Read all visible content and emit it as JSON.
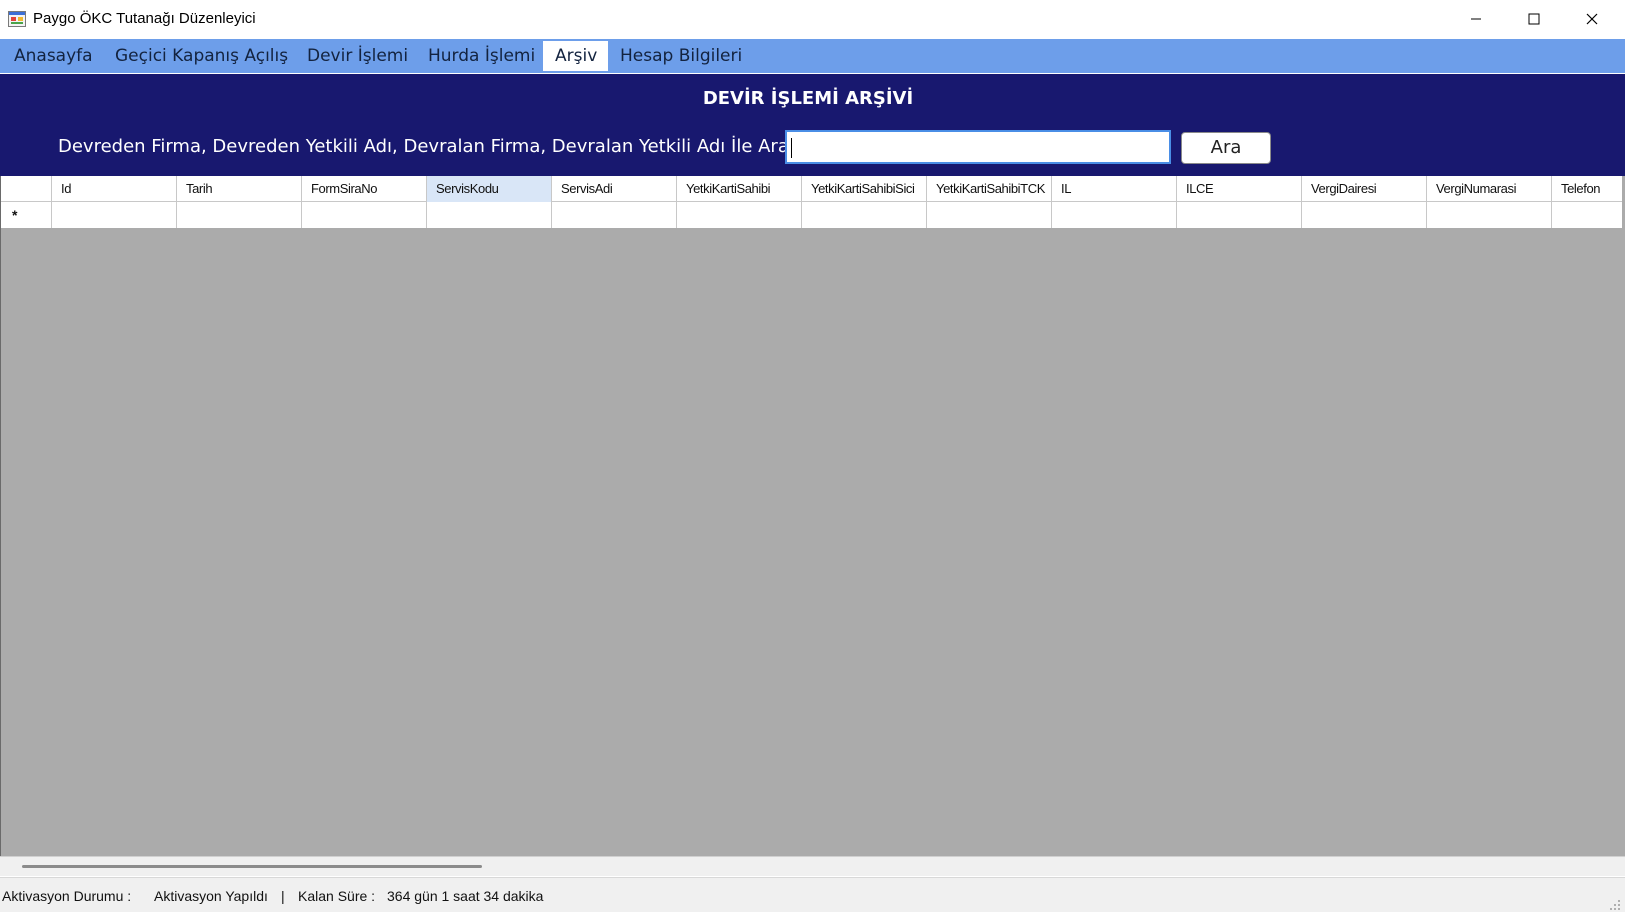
{
  "window": {
    "title": "Paygo ÖKC Tutanağı Düzenleyici",
    "icon": "app-form-icon",
    "controls": [
      "minimize-icon",
      "maximize-icon",
      "close-icon"
    ]
  },
  "menu": {
    "items": [
      {
        "label": "Anasayfa",
        "active": false
      },
      {
        "label": "Geçici Kapanış Açılış",
        "active": false
      },
      {
        "label": "Devir İşlemi",
        "active": false
      },
      {
        "label": "Hurda İşlemi",
        "active": false
      },
      {
        "label": "Arşiv",
        "active": true
      },
      {
        "label": "Hesap Bilgileri",
        "active": false
      }
    ]
  },
  "archive": {
    "title": "DEVİR İŞLEMİ ARŞİVİ",
    "search_label": "Devreden Firma, Devreden Yetkili Adı, Devralan Firma, Devralan Yetkili Adı İle Ara :",
    "search_value": "",
    "search_button": "Ara"
  },
  "grid": {
    "columns": [
      "Id",
      "Tarih",
      "FormSiraNo",
      "ServisKodu",
      "ServisAdi",
      "YetkiKartiSahibi",
      "YetkiKartiSahibiSici",
      "YetkiKartiSahibiTCK",
      "IL",
      "ILCE",
      "VergiDairesi",
      "VergiNumarasi",
      "Telefon"
    ],
    "selected_column": "ServisKodu",
    "new_row_marker": "*",
    "rows": []
  },
  "status": {
    "activation_label": "Aktivasyon Durumu :",
    "activation_value": "Aktivasyon Yapıldı",
    "separator": "|",
    "remaining_label": "Kalan Süre :",
    "remaining_value": "364 gün 1 saat 34 dakika"
  },
  "colors": {
    "menubar": "#6d9eea",
    "header_panel": "#18186f",
    "grid_background": "#ababab"
  }
}
